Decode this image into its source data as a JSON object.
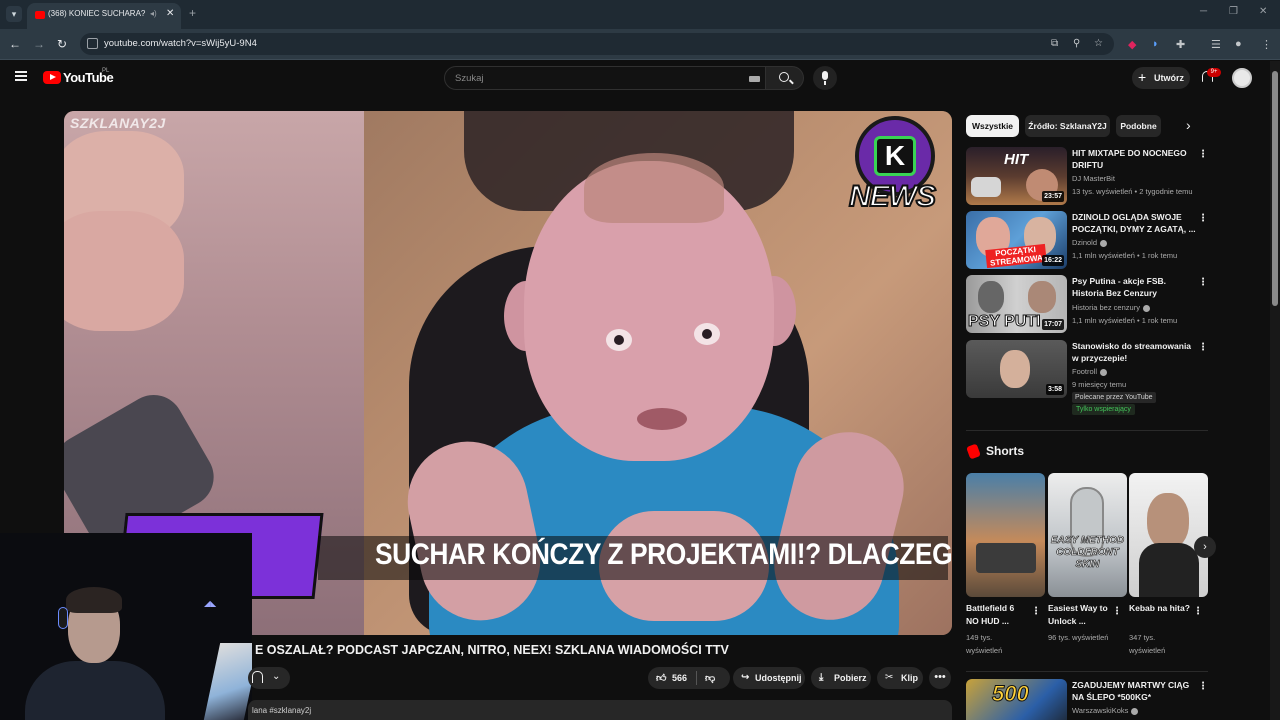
{
  "browser": {
    "tab_title": "(368) KONIEC SUCHARA? R",
    "url": "youtube.com/watch?v=sWij5yU-9N4"
  },
  "youtube": {
    "logo_text": "YouTube",
    "country_code": "PL",
    "search_placeholder": "Szukaj",
    "create_label": "Utwórz",
    "notifications_badge": "9+"
  },
  "player": {
    "watermark": "SZKLANAY2J",
    "news_text": "NEWS",
    "news_k": "K",
    "caption": "SUCHAR KOŃCZY Z PROJEKTAMI!? DLACZEGO!?",
    "badge_text": "E"
  },
  "video": {
    "title": "E OSZALAŁ? PODCAST JAPCZAN, NITRO, NEEX! SZKLANA WIADOMOŚCI TTV",
    "likes": "566",
    "share_label": "Udostępnij",
    "download_label": "Pobierz",
    "clip_label": "Klip",
    "description_snippet": "lana #szklanay2j"
  },
  "sidebar": {
    "chips": [
      "Wszystkie",
      "Źródło: SzklanaY2J",
      "Podobne"
    ],
    "recommendations": [
      {
        "title": "HIT MIXTAPE DO NOCNEGO DRIFTU",
        "channel": "DJ MasterBit",
        "meta": "13 tys. wyświetleń • 2 tygodnie temu",
        "duration": "23:57",
        "verified": false
      },
      {
        "title": "DZINOLD OGLĄDA SWOJE POCZĄTKI, DYMY Z AGATĄ, ...",
        "channel": "Dzinold",
        "meta": "1,1 mln wyświetleń • 1 rok temu",
        "duration": "16:22",
        "verified": true
      },
      {
        "title": "Psy Putina - akcje FSB. Historia Bez Cenzury",
        "channel": "Historia bez cenzury",
        "meta": "1,1 mln wyświetleń • 1 rok temu",
        "duration": "17:07",
        "verified": true
      },
      {
        "title": "Stanowisko do streamowania w przyczepie!",
        "channel": "Footroll",
        "meta": "9 miesięcy temu",
        "duration": "3:58",
        "verified": true,
        "promo": "Polecane przez YouTube",
        "members": "Tylko wspierający"
      }
    ],
    "thumb_texts": {
      "hit": "HIT",
      "poczatki": "POCZĄTKI STREAMOWA",
      "psy": "PSY PUTI"
    },
    "shorts_title": "Shorts",
    "shorts": [
      {
        "title": "Battlefield 6 NO HUD ...",
        "views": "149 tys. wyświetleń"
      },
      {
        "title": "Easiest Way to Unlock ...",
        "views": "96 tys. wyświetleń",
        "overlay": "EASY METHOD COLDFRONT SKIN"
      },
      {
        "title": "Kebab na hita?",
        "views": "347 tys. wyświetleń"
      }
    ],
    "next_rec": {
      "title": "ZGADUJEMY MARTWY CIĄG NA ŚLEPO *500KG*",
      "channel": "WarszawskiKoks",
      "thumb_text": "500"
    }
  }
}
